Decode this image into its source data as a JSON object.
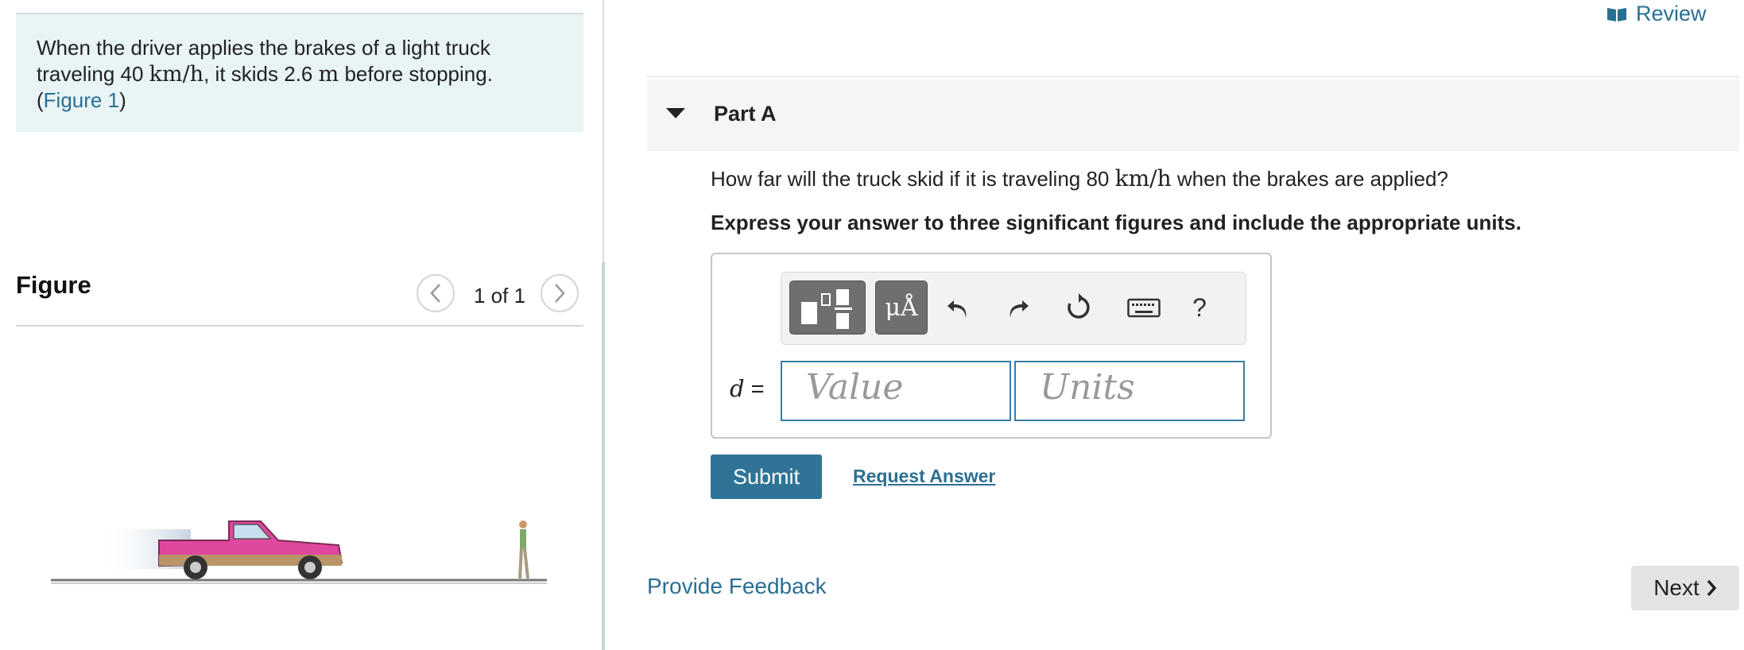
{
  "problem": {
    "text_part1": "When the driver applies the brakes of a light truck traveling 40 ",
    "speed_unit": "km/h",
    "text_part2": ", it skids 2.6 ",
    "dist_unit": "m",
    "text_part3": " before stopping.",
    "figure_link_open": "(",
    "figure_link_label": "Figure 1",
    "figure_link_close": ")"
  },
  "figure": {
    "title": "Figure",
    "pager_text": "1 of 1",
    "prev_icon": "chevron-left-icon",
    "next_icon": "chevron-right-icon"
  },
  "header": {
    "review_label": "Review",
    "review_icon": "book-icon"
  },
  "part": {
    "title": "Part A",
    "question_part1": "How far will the truck skid if it is traveling 80 ",
    "question_unit": "km/h",
    "question_part2": " when the brakes are applied?",
    "instruction": "Express your answer to three significant figures and include the appropriate units."
  },
  "answer": {
    "variable_label": "d",
    "equals": " =",
    "value_placeholder": "Value",
    "units_placeholder": "Units",
    "toolbar": {
      "templates_icon": "templates-icon",
      "units_button_label": "μÅ",
      "undo_icon": "undo-icon",
      "redo_icon": "redo-icon",
      "reset_icon": "reset-icon",
      "keyboard_icon": "keyboard-icon",
      "help_label": "?"
    }
  },
  "actions": {
    "submit_label": "Submit",
    "request_answer_label": "Request Answer",
    "feedback_label": "Provide Feedback",
    "next_label": "Next",
    "next_icon": "chevron-right-icon"
  },
  "colors": {
    "accent": "#2f7496",
    "link": "#2a6f93",
    "problem_bg": "#e8f4f6",
    "truck_body": "#e0479e"
  }
}
